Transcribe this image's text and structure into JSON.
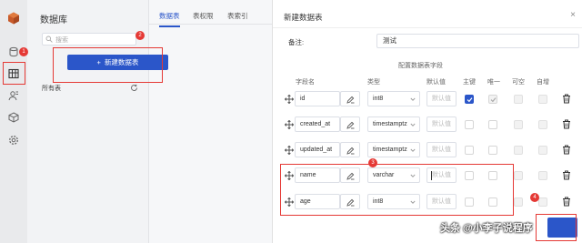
{
  "app": {
    "sidebar_title": "数据库",
    "search_placeholder": "搜索",
    "new_table_button": "新建数据表",
    "all_tables_label": "所有表",
    "tabs": [
      {
        "label": "数据表",
        "active": true
      },
      {
        "label": "表权限",
        "active": false
      },
      {
        "label": "表索引",
        "active": false
      }
    ]
  },
  "rail_icons": [
    "database-icon",
    "grid-icon",
    "users-icon",
    "box-icon",
    "settings-icon"
  ],
  "dialog": {
    "title": "新建数据表",
    "close_glyph": "×",
    "remark_label": "备注:",
    "remark_value": "测试",
    "config_title": "配置数据表字段",
    "columns": {
      "field_name": "字段名",
      "type": "类型",
      "default": "默认值",
      "primary_key": "主键",
      "unique": "唯一",
      "nullable": "可空",
      "auto_increment": "自增"
    },
    "default_placeholder": "默认值",
    "rows": [
      {
        "name": "id",
        "type": "int8",
        "primary": "checked",
        "unique": "checked-disabled",
        "nullable": "disabled",
        "auto": "disabled"
      },
      {
        "name": "created_at",
        "type": "timestamptz",
        "primary": "unchecked",
        "unique": "unchecked",
        "nullable": "disabled",
        "auto": "disabled"
      },
      {
        "name": "updated_at",
        "type": "timestamptz",
        "primary": "unchecked",
        "unique": "unchecked",
        "nullable": "disabled",
        "auto": "disabled"
      },
      {
        "name": "name",
        "type": "varchar",
        "primary": "unchecked",
        "unique": "unchecked",
        "nullable": "disabled",
        "auto": "disabled"
      },
      {
        "name": "age",
        "type": "int8",
        "primary": "unchecked",
        "unique": "unchecked",
        "nullable": "disabled",
        "auto": "disabled"
      }
    ]
  },
  "annotations": [
    "1",
    "2",
    "3",
    "4"
  ],
  "watermark": "头条 @小李子说程序",
  "colors": {
    "accent": "#2b56c9",
    "annotation_red": "#e53935",
    "rail_bg": "#e9eaec"
  }
}
